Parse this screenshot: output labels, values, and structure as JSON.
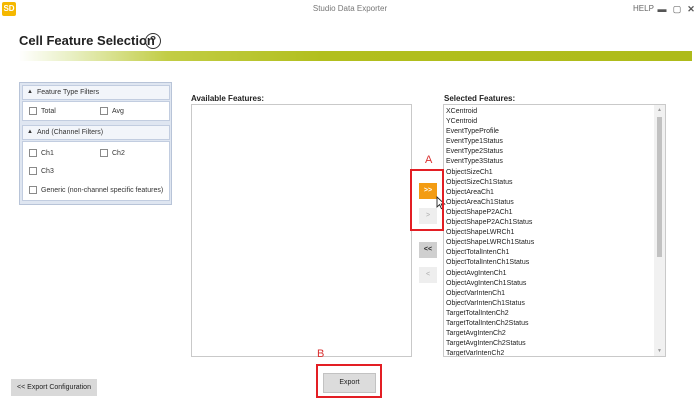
{
  "window": {
    "title": "Studio Data Exporter",
    "help": "HELP",
    "app_icon_text": "SD",
    "minimize": "▬",
    "maximize": "▢",
    "close": "✕"
  },
  "header": {
    "title": "Cell Feature Selection",
    "help_symbol": "?"
  },
  "filters": {
    "feature_type": {
      "title": "Feature Type Filters",
      "options": [
        "Total",
        "Avg"
      ]
    },
    "channel": {
      "title": "And (Channel Filters)",
      "options": [
        "Ch1",
        "Ch2",
        "Ch3",
        "Generic (non-channel specific features)"
      ]
    },
    "collapse_glyph": "▲"
  },
  "available": {
    "label": "Available Features:"
  },
  "selected": {
    "label": "Selected Features:",
    "items": [
      "XCentroid",
      "YCentroid",
      "EventTypeProfile",
      "EventType1Status",
      "EventType2Status",
      "EventType3Status",
      "ObjectSizeCh1",
      "ObjectSizeCh1Status",
      "ObjectAreaCh1",
      "ObjectAreaCh1Status",
      "ObjectShapeP2ACh1",
      "ObjectShapeP2ACh1Status",
      "ObjectShapeLWRCh1",
      "ObjectShapeLWRCh1Status",
      "ObjectTotalIntenCh1",
      "ObjectTotalIntenCh1Status",
      "ObjectAvgIntenCh1",
      "ObjectAvgIntenCh1Status",
      "ObjectVarIntenCh1",
      "ObjectVarIntenCh1Status",
      "TargetTotalIntenCh2",
      "TargetTotalIntenCh2Status",
      "TargetAvgIntenCh2",
      "TargetAvgIntenCh2Status",
      "TargetVarIntenCh2"
    ]
  },
  "transfer": {
    "add_all": ">>",
    "add": ">",
    "remove_all": "<<",
    "remove": "<"
  },
  "annotations": {
    "a": "A",
    "b": "B"
  },
  "buttons": {
    "export_config": "<< Export Configuration",
    "export": "Export"
  },
  "colors": {
    "accent": "#aebb1a",
    "active_button": "#f39c12",
    "annotation": "#e31e24"
  }
}
